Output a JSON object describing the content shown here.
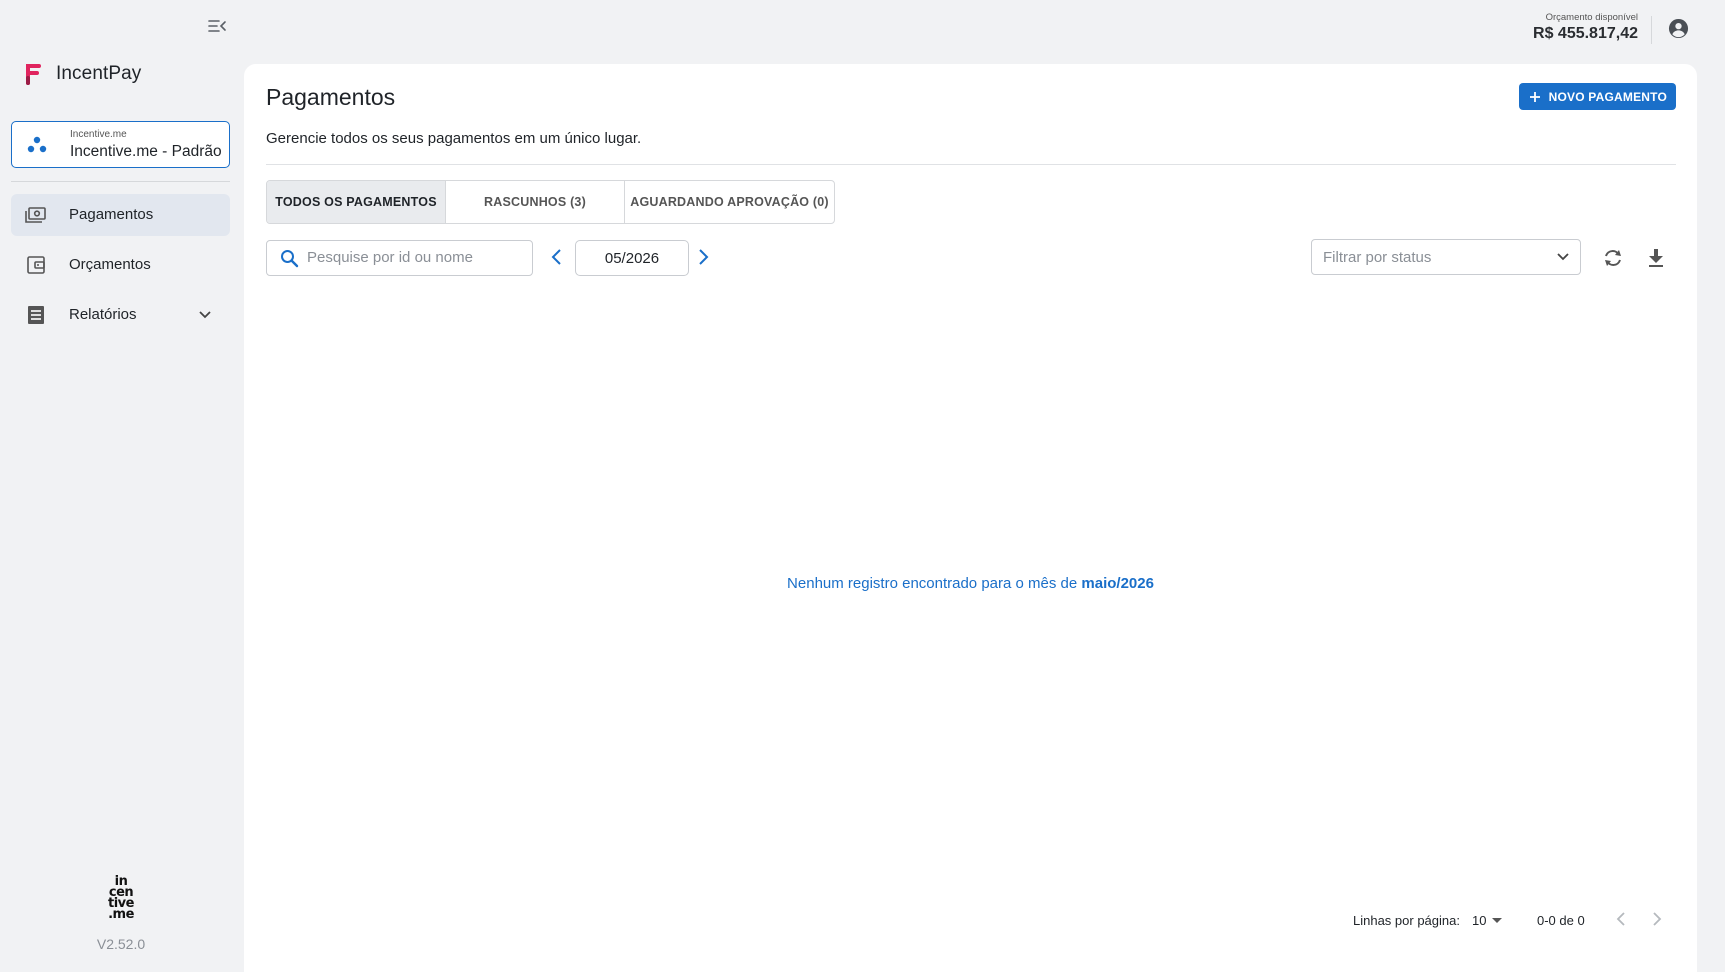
{
  "sidebar": {
    "app_name": "IncentPay",
    "org": {
      "small_label": "Incentive.me",
      "name": "Incentive.me - Padrão"
    },
    "items": [
      {
        "label": "Pagamentos",
        "icon": "payments-icon",
        "active": true
      },
      {
        "label": "Orçamentos",
        "icon": "wallet-icon",
        "active": false
      },
      {
        "label": "Relatórios",
        "icon": "reports-icon",
        "active": false
      }
    ],
    "footer_logo": [
      "in",
      "cen",
      "tive",
      ".me"
    ],
    "version": "V2.52.0"
  },
  "topbar": {
    "budget_label": "Orçamento disponível",
    "budget_value": "R$ 455.817,42"
  },
  "main": {
    "title": "Pagamentos",
    "subtitle": "Gerencie todos os seus pagamentos em um único lugar.",
    "new_button": "NOVO PAGAMENTO",
    "tabs": [
      {
        "label": "TODOS OS PAGAMENTOS",
        "active": true
      },
      {
        "label": "RASCUNHOS (3)",
        "active": false
      },
      {
        "label": "AGUARDANDO APROVAÇÃO (0)",
        "active": false
      }
    ],
    "search_placeholder": "Pesquise por id ou nome",
    "month": "05/2026",
    "status_placeholder": "Filtrar por status",
    "empty_message_prefix": "Nenhum registro encontrado para o mês de ",
    "empty_message_month": "maio/2026",
    "pager": {
      "rows_label": "Linhas por página:",
      "rows_value": "10",
      "range": "0-0 de 0"
    }
  },
  "colors": {
    "accent": "#1a6fc9",
    "brand": "#e0245e",
    "background": "#f1f2f4"
  }
}
